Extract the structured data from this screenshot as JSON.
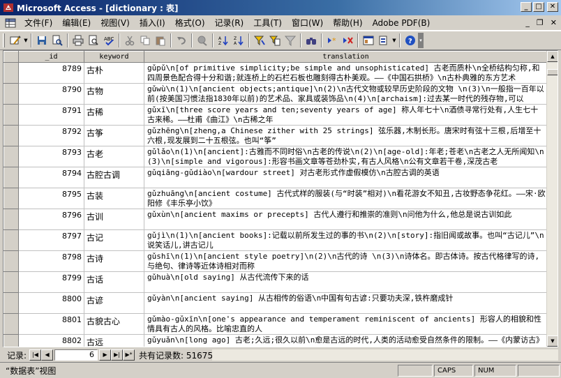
{
  "window": {
    "title": "Microsoft Access - [dictionary : 表]"
  },
  "menu": [
    {
      "label": "文件(F)"
    },
    {
      "label": "编辑(E)"
    },
    {
      "label": "视图(V)"
    },
    {
      "label": "插入(I)"
    },
    {
      "label": "格式(O)"
    },
    {
      "label": "记录(R)"
    },
    {
      "label": "工具(T)"
    },
    {
      "label": "窗口(W)"
    },
    {
      "label": "帮助(H)"
    },
    {
      "label": "Adobe PDF(B)"
    }
  ],
  "grid": {
    "columns": [
      "_id",
      "keyword",
      "translation"
    ],
    "rows": [
      {
        "id": "8789",
        "keyword": "古朴",
        "translation": "gǔpǔ\\n[of primitive simplicity;be simple and unsophisticated] 古老而质朴\\n全桥结构匀称,和四周景色配合得十分和谐;就连桥上的石栏石板也雕刻得古朴美观。——《中国石拱桥》\\n古朴典雅的东方艺术"
      },
      {
        "id": "8790",
        "keyword": "古物",
        "translation": "gǔwù\\n(1)\\n[ancient objects;antique]\\n(2)\\n古代文物或较早历史阶段的文物 \\n(3)\\n一般指一百年以前(按美国习惯法指1830年以前)的艺术品、家具或装饰品\\n(4)\\n[archaism]:过去某一时代的残存物,可以"
      },
      {
        "id": "8791",
        "keyword": "古稀",
        "translation": "gǔxī\\n[three score years and ten;seventy years of age] 称人年七十\\n酒债寻常行处有,人生七十古来稀。——杜甫《曲江》\\n古稀之年"
      },
      {
        "id": "8792",
        "keyword": "古筝",
        "translation": "gǔzhēng\\n[zheng,a Chinese zither with 25 strings] 弦乐器,木制长形。唐宋时有弦十三根,后增至十六根,现发展到二十五根弦。也叫“筝”"
      },
      {
        "id": "8793",
        "keyword": "古老",
        "translation": "gǔlǎo\\n(1)\\n[ancient]:古雅而不同时俗\\n古老的传说\\n(2)\\n[age-old]:年老;苍老\\n古老之人无所闻知\\n(3)\\n[simple and vigorous]:形容书画文章等苍劲朴实,有古人风格\\n公有文章若干卷,深茂古老"
      },
      {
        "id": "8794",
        "keyword": "古腔古调",
        "translation": "gǔqiāng-gǔdiào\\n[wardour street] 对古老形式作虚假模仿\\n古腔古调的英语"
      },
      {
        "id": "8795",
        "keyword": "古装",
        "translation": "gǔzhuāng\\n[ancient costume] 古代式样的服装(与“时装”相对)\\n看花游女不知丑,古妆野态争花红。——宋·欧阳修《丰乐亭小饮》"
      },
      {
        "id": "8796",
        "keyword": "古训",
        "translation": "gǔxùn\\n[ancient maxims or precepts] 古代人遵行和推崇的准则\\n问他为什么,他总是说古训如此"
      },
      {
        "id": "8797",
        "keyword": "古记",
        "translation": "gǔjì\\n(1)\\n[ancient books]:记载以前所发生过的事的书\\n(2)\\n[story]:指旧闻或故事。也叫“古记儿”\\n说笑话儿,讲古记儿"
      },
      {
        "id": "8798",
        "keyword": "古诗",
        "translation": "gǔshī\\n(1)\\n[ancient style poetry]\\n(2)\\n古代的诗 \\n(3)\\n诗体名。即古体诗。按古代格律写的诗,与绝句、律诗等近体诗相对而称"
      },
      {
        "id": "8799",
        "keyword": "古话",
        "translation": "gǔhuà\\n[old saying] 从古代流传下来的话"
      },
      {
        "id": "8800",
        "keyword": "古谚",
        "translation": "gǔyàn\\n[ancient saying] 从古相传的俗语\\n中国有句古谚:只要功夫深,铁杵磨成针"
      },
      {
        "id": "8801",
        "keyword": "古貌古心",
        "translation": "gǔmào-gǔxīn\\n[one's appearance and temperament reminiscent of ancients] 形容人的相貌和性情具有古人的风格。比喻忠直的人"
      },
      {
        "id": "8802",
        "keyword": "古远",
        "translation": "gǔyuǎn\\n[long ago] 古老;久远;很久以前\\n愈是古远的时代,人类的活动愈受自然条件的限制。——《内蒙访古》"
      }
    ]
  },
  "navigation": {
    "label": "记录:",
    "current": "6",
    "total_text": "共有记录数: 51675"
  },
  "status": {
    "text": "“数据表”视图",
    "caps": "CAPS",
    "num": "NUM"
  }
}
